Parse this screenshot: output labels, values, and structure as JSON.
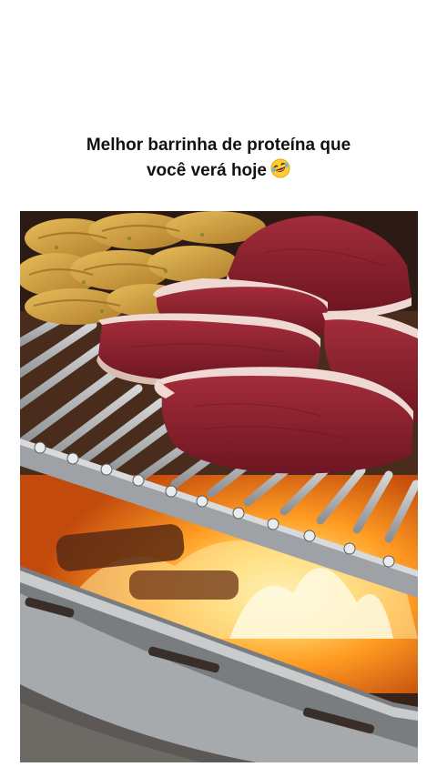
{
  "caption": {
    "line1": "Melhor barrinha de proteína que",
    "line2": "você verá hoje",
    "emoji": "rolling-on-the-floor-laughing-emoji"
  },
  "photo": {
    "subject": "grill-with-steaks-and-chicken",
    "colors": {
      "meat": "#8a1f2c",
      "fat": "#efd9d2",
      "chicken": "#d7a447",
      "fire": "#ff9b22",
      "steel": "#b9bcbf"
    }
  }
}
